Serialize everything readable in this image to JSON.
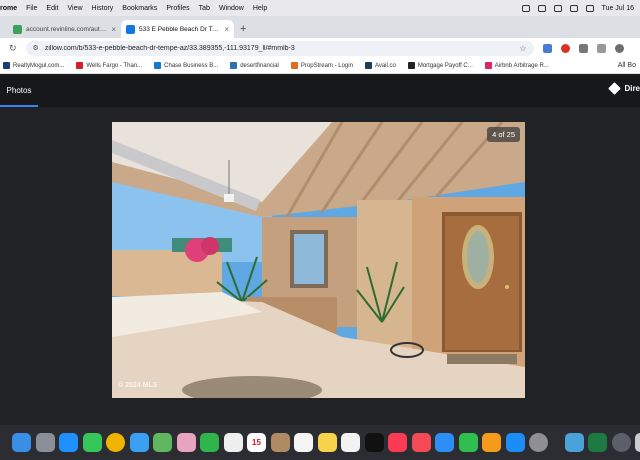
{
  "menubar": {
    "app_name": "rome",
    "items": [
      "File",
      "Edit",
      "View",
      "History",
      "Bookmarks",
      "Profiles",
      "Tab",
      "Window",
      "Help"
    ],
    "clock": "Tue Jul 16"
  },
  "tabs": [
    {
      "title": "account.revinline.com/auth/...",
      "favicon_color": "#3c9f5a",
      "active": false
    },
    {
      "title": "533 E Pebble Beach Dr Temp...",
      "favicon_color": "#1277e1",
      "active": true
    }
  ],
  "address": {
    "url": "zillow.com/b/533-e-pebble-beach-dr-tempe-az/33.389355,-111.93179_ll/#mmlb-3"
  },
  "bookmarks": [
    {
      "label": "RealtyMogul.com...",
      "color": "#1a3d7c"
    },
    {
      "label": "Wells Fargo - Than...",
      "color": "#d71e28"
    },
    {
      "label": "Chase Business B...",
      "color": "#117aca"
    },
    {
      "label": "desertfinancial",
      "color": "#2c6fb7"
    },
    {
      "label": "PropStream - Login",
      "color": "#e56a1e"
    },
    {
      "label": "Avail.co",
      "color": "#1f3b57"
    },
    {
      "label": "Mortgage Payoff C...",
      "color": "#222222"
    },
    {
      "label": "Airbnb Arbitrage R...",
      "color": "#e0245e"
    }
  ],
  "bookmarks_more": "All Bo",
  "viewer": {
    "tab_photos": "Photos",
    "tab_other": "",
    "directions": "Dire",
    "photo_counter": "4 of 25",
    "watermark": "© 2024 MLS"
  },
  "dock": [
    {
      "icon": "finder-icon",
      "color": "#3a8ee6"
    },
    {
      "icon": "launchpad-icon",
      "color": "#8a8f98"
    },
    {
      "icon": "safari-icon",
      "color": "#1e90ff"
    },
    {
      "icon": "messages-icon",
      "color": "#35c759"
    },
    {
      "icon": "chrome-icon",
      "color": "#f0b400"
    },
    {
      "icon": "mail-icon",
      "color": "#3aa0f2"
    },
    {
      "icon": "maps-icon",
      "color": "#5fb85f"
    },
    {
      "icon": "photos-icon",
      "color": "#e8a3c1"
    },
    {
      "icon": "facetime-icon",
      "color": "#2fb54b"
    },
    {
      "icon": "clock-icon",
      "color": "#eeeeee"
    },
    {
      "icon": "calendar-icon",
      "color": "#ffffff"
    },
    {
      "icon": "contacts-icon",
      "color": "#b08a63"
    },
    {
      "icon": "reminders-icon",
      "color": "#f5f5f5"
    },
    {
      "icon": "notes-icon",
      "color": "#f7d24c"
    },
    {
      "icon": "freeform-icon",
      "color": "#f2f2f2"
    },
    {
      "icon": "appletv-icon",
      "color": "#111111"
    },
    {
      "icon": "music-icon",
      "color": "#fb3b53"
    },
    {
      "icon": "news-icon",
      "color": "#f44a55"
    },
    {
      "icon": "keynote-icon",
      "color": "#2d8ef5"
    },
    {
      "icon": "numbers-icon",
      "color": "#2fbf4f"
    },
    {
      "icon": "pages-icon",
      "color": "#f59b1c"
    },
    {
      "icon": "appstore-icon",
      "color": "#1c8df5"
    },
    {
      "icon": "settings-icon",
      "color": "#8e8e93"
    },
    {
      "icon": "preview-icon",
      "color": "#4aa3d8"
    },
    {
      "icon": "excel-icon",
      "color": "#1d7a43"
    },
    {
      "icon": "quicktime-icon",
      "color": "#5a5f6a"
    },
    {
      "icon": "trash-icon",
      "color": "#c9ccd1"
    }
  ],
  "dock_calendar_day": "15"
}
